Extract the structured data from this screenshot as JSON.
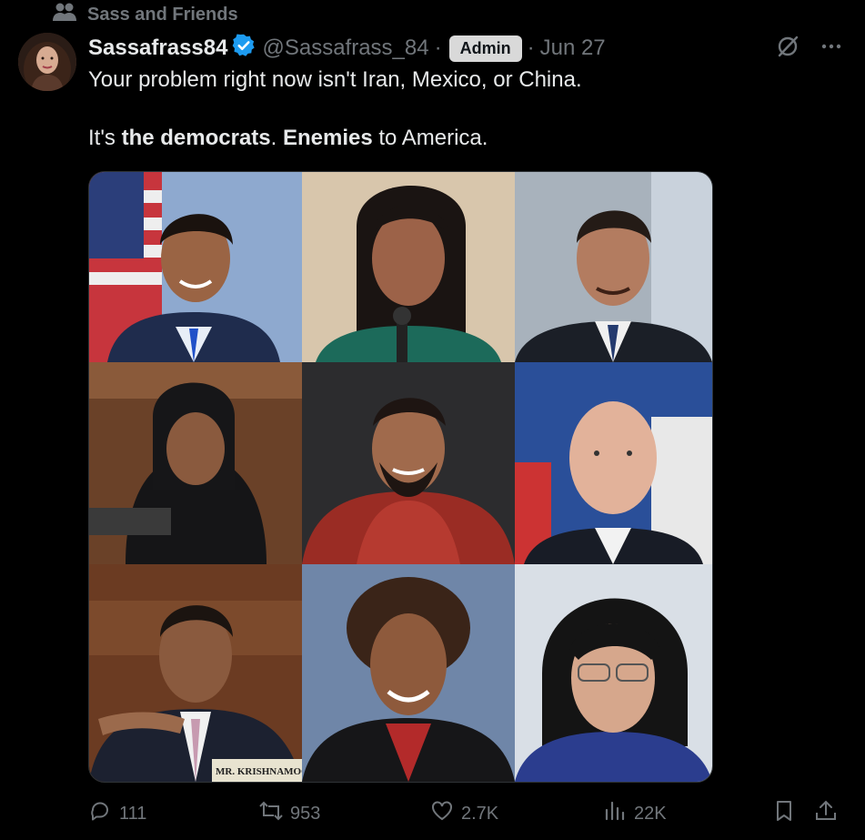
{
  "community": {
    "label": "Sass and Friends",
    "icon": "people-icon"
  },
  "author": {
    "display_name": "Sassafrass84",
    "handle": "@Sassafrass_84",
    "badge": "Admin",
    "date": "Jun 27",
    "separator": "·",
    "verified": true
  },
  "tweet": {
    "line1": "Your problem right now isn't Iran, Mexico, or China.",
    "line2_prefix": "It's ",
    "line2_bold1": "the democrats",
    "line2_mid": ". ",
    "line2_bold2": "Enemies",
    "line2_suffix": " to America."
  },
  "media": {
    "caption_plate": "MR. KRISHNAMOORT"
  },
  "actions": {
    "replies": "111",
    "reposts": "953",
    "likes": "2.7K",
    "views": "22K"
  },
  "colors": {
    "background": "#000000",
    "text": "#e7e9ea",
    "muted": "#71767b",
    "verified": "#1d9bf0",
    "badge_bg": "#d9d9d9"
  }
}
